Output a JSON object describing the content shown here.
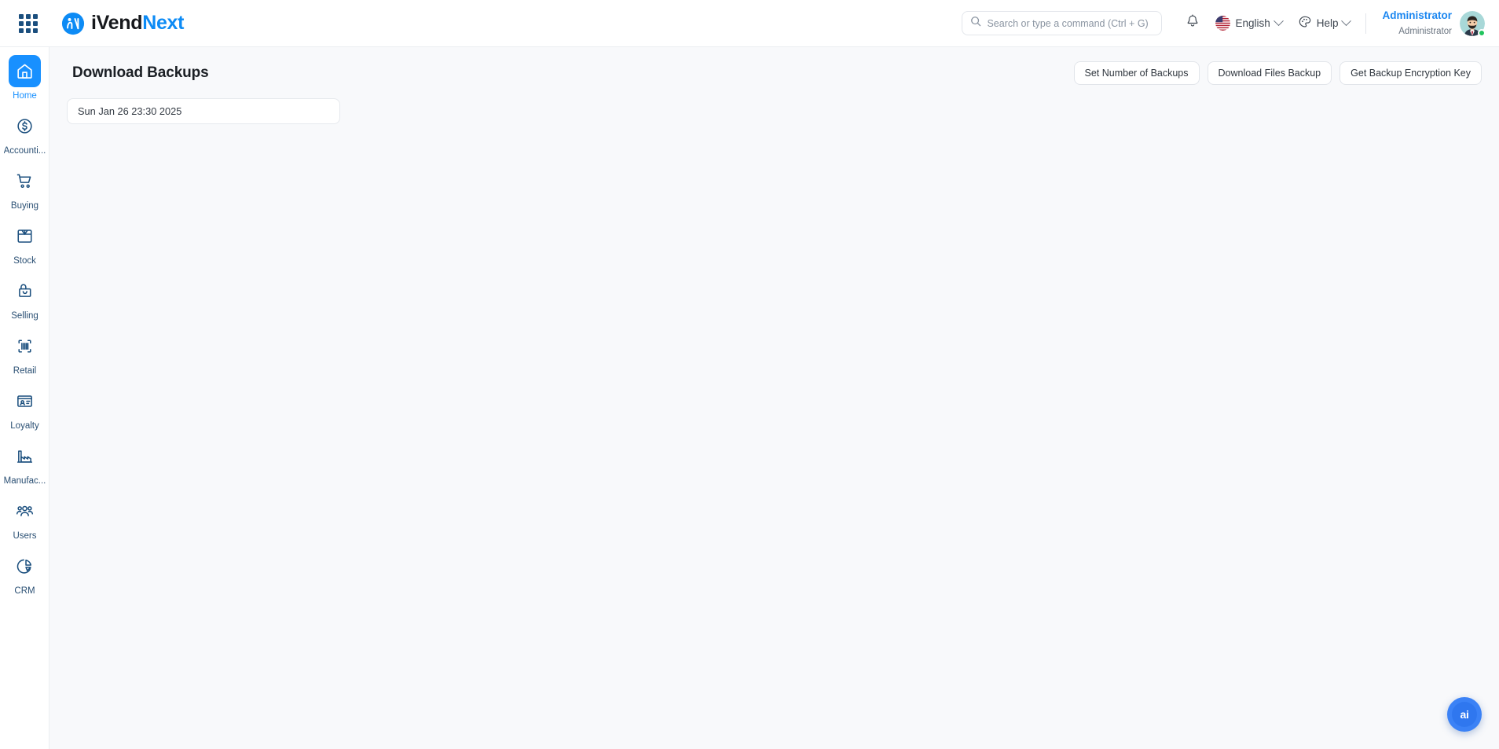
{
  "navbar": {
    "apps_icon": "grid-apps-icon",
    "brand": {
      "part1": "iVend",
      "part2": "Next",
      "logo_icon": "ivendnext-logo-icon"
    },
    "search": {
      "placeholder": "Search or type a command (Ctrl + G)",
      "value": "",
      "icon": "search-icon"
    },
    "notifications_icon": "bell-icon",
    "language": {
      "label": "English",
      "flag": "us-flag-icon",
      "chevron": "chevron-down-icon"
    },
    "help": {
      "label": "Help",
      "icon": "palette-icon",
      "chevron": "chevron-down-icon"
    },
    "user": {
      "name": "Administrator",
      "role": "Administrator",
      "avatar": "user-avatar",
      "status": "online"
    }
  },
  "sidebar": {
    "items": [
      {
        "label": "Home",
        "icon": "home-icon",
        "active": true
      },
      {
        "label": "Accounti...",
        "icon": "dollar-circle-icon",
        "active": false
      },
      {
        "label": "Buying",
        "icon": "shopping-cart-icon",
        "active": false
      },
      {
        "label": "Stock",
        "icon": "box-icon",
        "active": false
      },
      {
        "label": "Selling",
        "icon": "shopping-bag-icon",
        "active": false
      },
      {
        "label": "Retail",
        "icon": "barcode-icon",
        "active": false
      },
      {
        "label": "Loyalty",
        "icon": "id-card-icon",
        "active": false
      },
      {
        "label": "Manufac...",
        "icon": "factory-icon",
        "active": false
      },
      {
        "label": "Users",
        "icon": "users-icon",
        "active": false
      },
      {
        "label": "CRM",
        "icon": "pie-chart-icon",
        "active": false
      }
    ]
  },
  "page": {
    "title": "Download Backups",
    "actions": [
      {
        "label": "Set Number of Backups"
      },
      {
        "label": "Download Files Backup"
      },
      {
        "label": "Get Backup Encryption Key"
      }
    ],
    "backups": [
      {
        "label": "Sun Jan 26 23:30 2025"
      }
    ]
  },
  "fab": {
    "label": "ai",
    "name": "ai-assistant-button"
  },
  "colors": {
    "accent": "#1890ff",
    "brand_blue": "#0d8bf5",
    "sidebar_icon": "#1b4f7e",
    "content_bg": "#f8f9fb",
    "status_online": "#21c45d"
  }
}
